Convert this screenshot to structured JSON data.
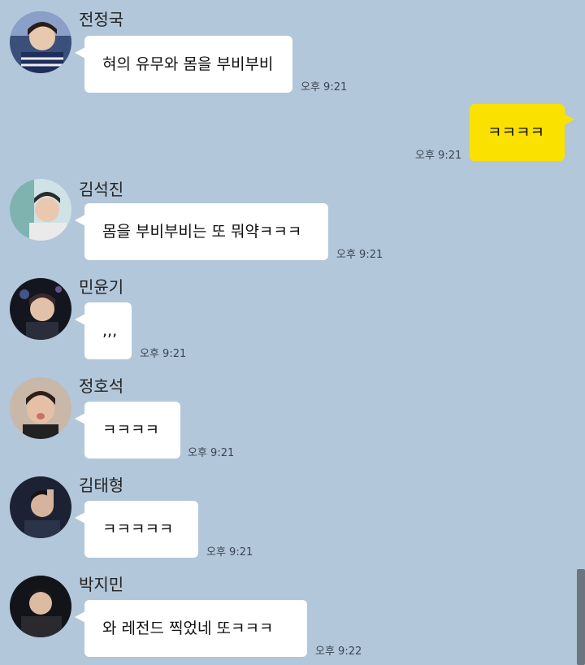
{
  "messages": [
    {
      "sender": "전정국",
      "text": "혀의 유무와 몸을 부비부비",
      "time": "오후 9:21"
    },
    {
      "sender": "",
      "text": "ㅋㅋㅋㅋ",
      "time": "오후 9:21"
    },
    {
      "sender": "김석진",
      "text": "몸을 부비부비는 또 뭐약ㅋㅋㅋ",
      "time": "오후 9:21"
    },
    {
      "sender": "민윤기",
      "text": ",,,",
      "time": "오후 9:21"
    },
    {
      "sender": "정호석",
      "text": "ㅋㅋㅋㅋ",
      "time": "오후 9:21"
    },
    {
      "sender": "김태형",
      "text": "ㅋㅋㅋㅋㅋ",
      "time": "오후 9:21"
    },
    {
      "sender": "박지민",
      "text": "와 레전드 찍었네 또ㅋㅋㅋ",
      "time": "오후 9:22"
    }
  ],
  "colors": {
    "background": "#b2c7da",
    "my_bubble": "#fae100",
    "other_bubble": "#ffffff"
  }
}
